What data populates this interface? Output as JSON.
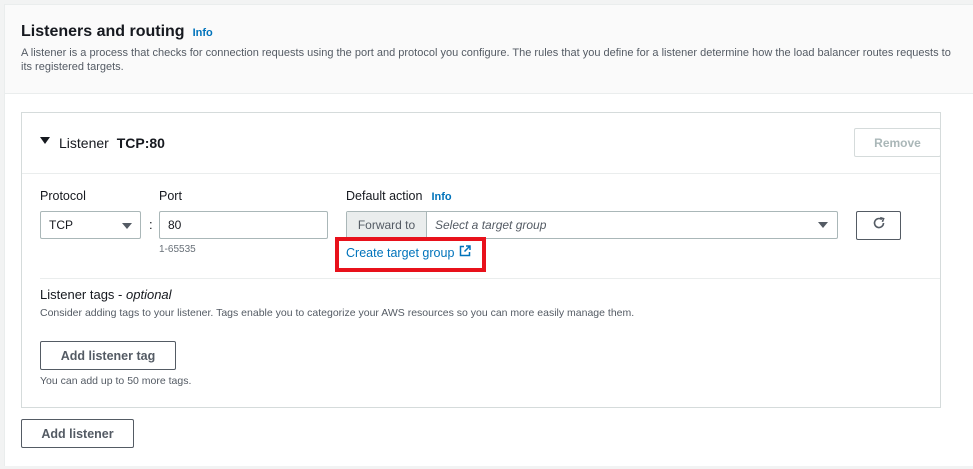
{
  "header": {
    "title": "Listeners and routing",
    "info": "Info",
    "description": "A listener is a process that checks for connection requests using the port and protocol you configure. The rules that you define for a listener determine how the load balancer routes requests to its registered targets."
  },
  "listener": {
    "prefix": "Listener",
    "name": "TCP:80",
    "remove_label": "Remove",
    "protocol": {
      "label": "Protocol",
      "value": "TCP"
    },
    "port": {
      "label": "Port",
      "value": "80",
      "hint": "1-65535"
    },
    "separator": ":",
    "default_action": {
      "label": "Default action",
      "info": "Info",
      "prefix": "Forward to",
      "placeholder": "Select a target group",
      "create_link": "Create target group"
    },
    "tags": {
      "title": "Listener tags - ",
      "title_optional": "optional",
      "description": "Consider adding tags to your listener. Tags enable you to categorize your AWS resources so you can more easily manage them.",
      "add_label": "Add listener tag",
      "limit": "You can add up to 50 more tags."
    }
  },
  "footer": {
    "add_listener_label": "Add listener"
  },
  "colors": {
    "link": "#0073bb",
    "highlight": "#e8111b",
    "border": "#aab7b8"
  },
  "icons": {
    "refresh": "refresh-icon",
    "external": "external-link-icon",
    "expand": "caret-down-icon"
  }
}
